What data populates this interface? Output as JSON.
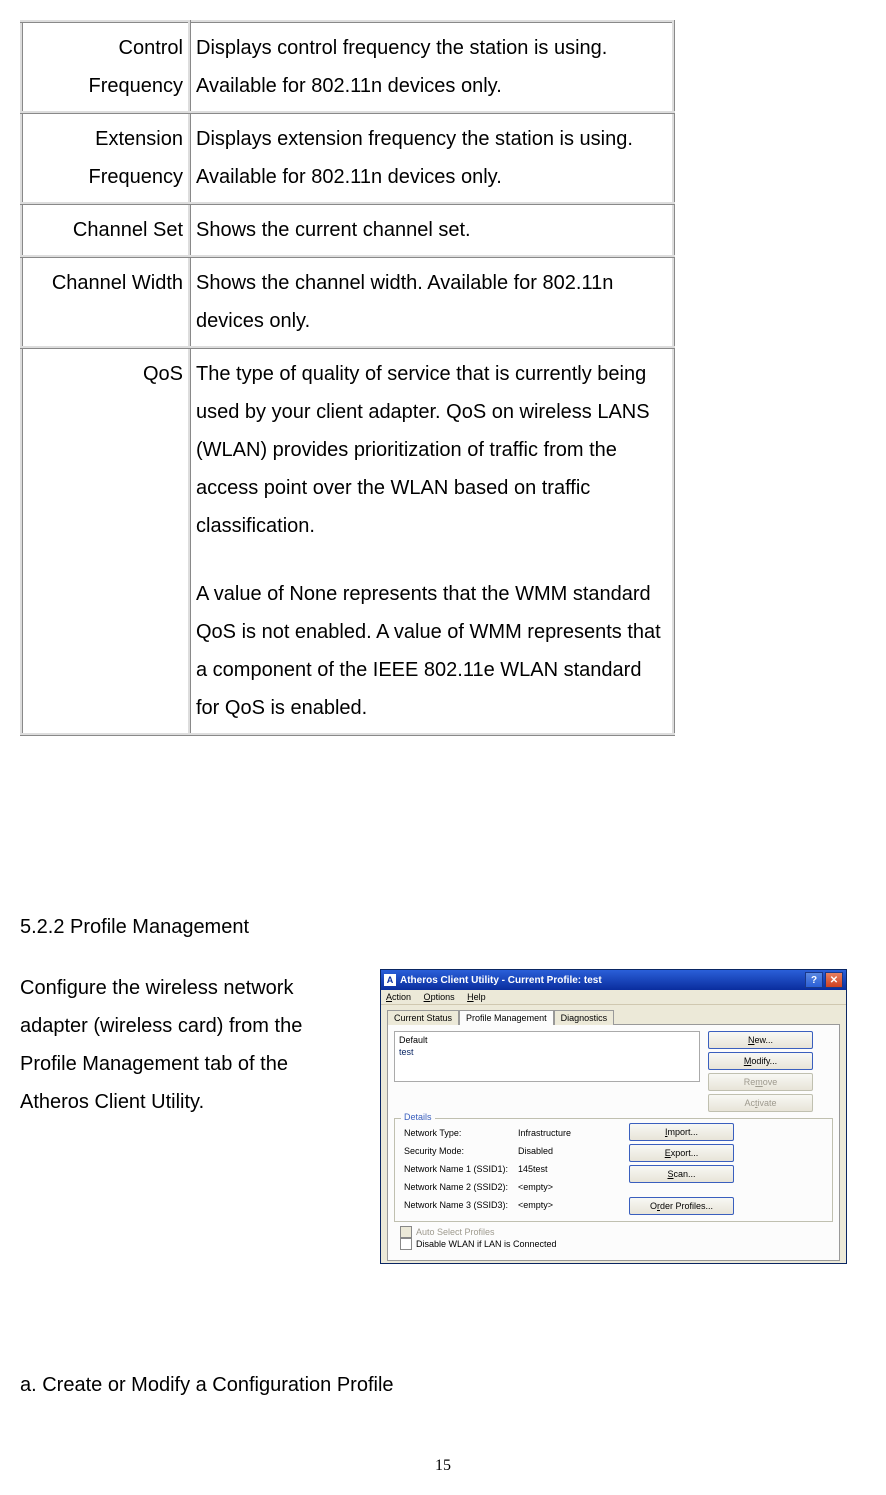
{
  "table": {
    "rows": [
      {
        "label": "Control Frequency",
        "desc": "Displays control frequency the station is using. Available for 802.11n devices only."
      },
      {
        "label": "Extension Frequency",
        "desc": "Displays extension frequency the station is using. Available for 802.11n devices only."
      },
      {
        "label": "Channel Set",
        "desc": "Shows the current channel set."
      },
      {
        "label": "Channel Width",
        "desc": "Shows the channel width. Available for 802.11n devices only."
      },
      {
        "label": "QoS",
        "desc_p1": "The type of quality of service that is currently being used by your client adapter. QoS on wireless LANS (WLAN) provides prioritization of traffic from the access point over the WLAN based on traffic classification.",
        "desc_p2": "A value of None represents that the WMM standard QoS is not enabled. A value of WMM represents that a component of the IEEE 802.11e WLAN standard for QoS is enabled."
      }
    ]
  },
  "section": {
    "heading": "5.2.2 Profile Management",
    "description": "Configure the wireless network adapter (wireless card) from the Profile Management tab of the Atheros Client Utility."
  },
  "window": {
    "app_icon": "A",
    "title": "Atheros Client Utility - Current Profile: test",
    "menu": {
      "action": "Action",
      "options": "Options",
      "help": "Help"
    },
    "tabs": {
      "current_status": "Current Status",
      "profile_management": "Profile Management",
      "diagnostics": "Diagnostics"
    },
    "profiles": [
      {
        "name": "Default",
        "selected": false
      },
      {
        "name": "test",
        "selected": true
      }
    ],
    "buttons": {
      "new": "New...",
      "modify": "Modify...",
      "remove": "Remove",
      "activate": "Activate",
      "import": "Import...",
      "export": "Export...",
      "scan": "Scan...",
      "order": "Order Profiles..."
    },
    "details": {
      "title": "Details",
      "rows": [
        {
          "label": "Network Type:",
          "value": "Infrastructure"
        },
        {
          "label": "Security Mode:",
          "value": "Disabled"
        },
        {
          "label": "Network Name 1 (SSID1):",
          "value": "145test"
        },
        {
          "label": "Network Name 2 (SSID2):",
          "value": "<empty>"
        },
        {
          "label": "Network Name 3 (SSID3):",
          "value": "<empty>"
        }
      ]
    },
    "checkboxes": {
      "auto_select": "Auto Select Profiles",
      "disable_wlan": "Disable WLAN if LAN is Connected"
    }
  },
  "subsection": "a.  Create or Modify a Configuration Profile",
  "page_number": "15"
}
